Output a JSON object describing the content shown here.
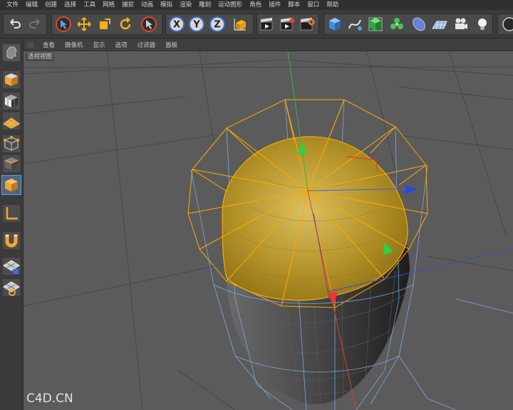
{
  "menubar": {
    "items": [
      "文件",
      "编辑",
      "创建",
      "选择",
      "工具",
      "网格",
      "捕捉",
      "动画",
      "模拟",
      "渲染",
      "雕刻",
      "运动图形",
      "角色",
      "插件",
      "脚本",
      "窗口",
      "帮助"
    ]
  },
  "toolbar": {
    "axis_x": "X",
    "axis_y": "Y",
    "axis_z": "Z"
  },
  "view_menu": {
    "items": [
      "查看",
      "摄像机",
      "显示",
      "选项",
      "过滤器",
      "面板"
    ]
  },
  "viewport": {
    "label": "透视视图",
    "watermark": "C4D.CN",
    "background_color": "#5b5b5b",
    "selection_color": "#ffaa00",
    "object_color": "#c7a31f"
  }
}
